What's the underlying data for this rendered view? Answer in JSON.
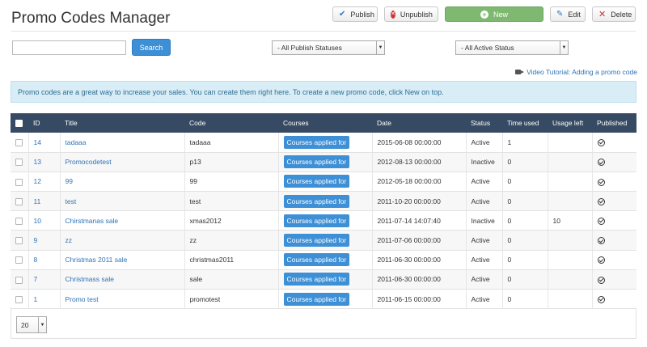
{
  "page": {
    "title": "Promo Codes Manager"
  },
  "toolbar": {
    "publish_label": "Publish",
    "unpublish_label": "Unpublish",
    "new_label": "New",
    "edit_label": "Edit",
    "delete_label": "Delete"
  },
  "filters": {
    "search_value": "",
    "search_button": "Search",
    "publish_status": "- All Publish Statuses",
    "active_status": "- All Active Status"
  },
  "tutorial_link": "Video Tutorial: Adding a promo code",
  "info_message": "Promo codes are a great way to increase your sales. You can create them right here. To create a new promo code, click New on top.",
  "table": {
    "headers": {
      "id": "ID",
      "title": "Title",
      "code": "Code",
      "courses": "Courses",
      "date": "Date",
      "status": "Status",
      "time_used": "Time used",
      "usage_left": "Usage left",
      "published": "Published"
    },
    "courses_button": "Courses applied for",
    "rows": [
      {
        "id": "14",
        "title": "tadaaa",
        "code": "tadaaa",
        "date": "2015-06-08 00:00:00",
        "status": "Active",
        "time_used": "1",
        "usage_left": ""
      },
      {
        "id": "13",
        "title": "Promocodetest",
        "code": "p13",
        "date": "2012-08-13 00:00:00",
        "status": "Inactive",
        "time_used": "0",
        "usage_left": ""
      },
      {
        "id": "12",
        "title": "99",
        "code": "99",
        "date": "2012-05-18 00:00:00",
        "status": "Active",
        "time_used": "0",
        "usage_left": ""
      },
      {
        "id": "11",
        "title": "test",
        "code": "test",
        "date": "2011-10-20 00:00:00",
        "status": "Active",
        "time_used": "0",
        "usage_left": ""
      },
      {
        "id": "10",
        "title": "Chirstmanas sale",
        "code": "xmas2012",
        "date": "2011-07-14 14:07:40",
        "status": "Inactive",
        "time_used": "0",
        "usage_left": "10"
      },
      {
        "id": "9",
        "title": "zz",
        "code": "zz",
        "date": "2011-07-06 00:00:00",
        "status": "Active",
        "time_used": "0",
        "usage_left": ""
      },
      {
        "id": "8",
        "title": "Christmas 2011 sale",
        "code": "christmas2011",
        "date": "2011-06-30 00:00:00",
        "status": "Active",
        "time_used": "0",
        "usage_left": ""
      },
      {
        "id": "7",
        "title": "Christmass sale",
        "code": "sale",
        "date": "2011-06-30 00:00:00",
        "status": "Active",
        "time_used": "0",
        "usage_left": ""
      },
      {
        "id": "1",
        "title": "Promo test",
        "code": "promotest",
        "date": "2011-06-15 00:00:00",
        "status": "Active",
        "time_used": "0",
        "usage_left": ""
      }
    ]
  },
  "pagination": {
    "limit": "20"
  },
  "icons": {
    "publish": "check-icon",
    "unpublish": "x-circle-icon",
    "new": "plus-circle-icon",
    "edit": "pencil-icon",
    "delete": "x-icon",
    "tutorial": "video-camera-icon",
    "published": "published-check-icon"
  },
  "colors": {
    "header_bg": "#364a63",
    "primary_button": "#3d8fd6",
    "new_button": "#7fb870",
    "info_bg": "#d9edf7",
    "link": "#2d74b8"
  }
}
